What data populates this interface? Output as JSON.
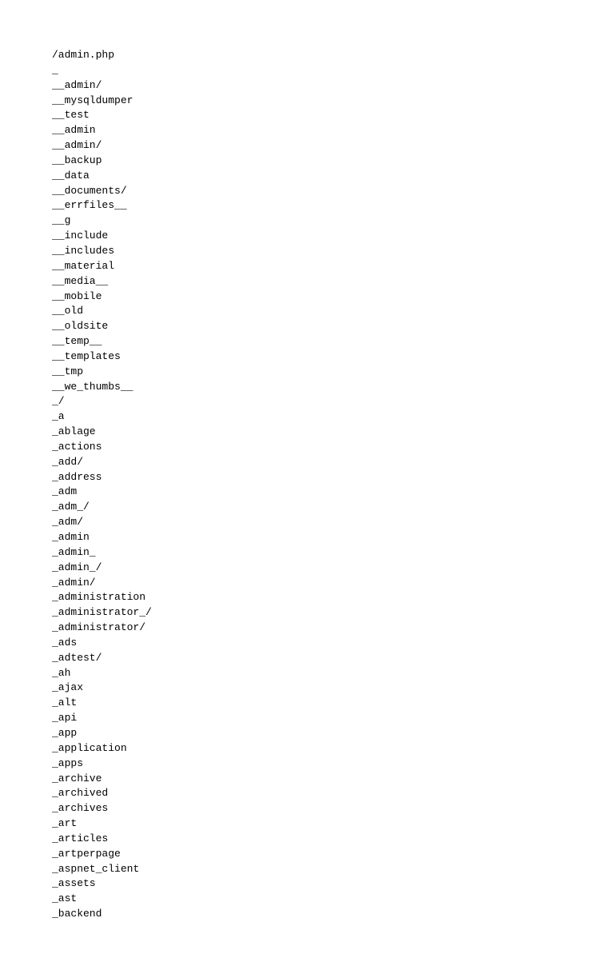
{
  "filelist": {
    "items": [
      "/admin.php",
      "_",
      "__admin/",
      "__mysqldumper",
      "__test",
      "__admin",
      "__admin/",
      "__backup",
      "__data",
      "__documents/",
      "__errfiles__",
      "__g",
      "__include",
      "__includes",
      "__material",
      "__media__",
      "__mobile",
      "__old",
      "__oldsite",
      "__temp__",
      "__templates",
      "__tmp",
      "__we_thumbs__",
      "_/",
      "_a",
      "_ablage",
      "_actions",
      "_add/",
      "_address",
      "_adm",
      "_adm_/",
      "_adm/",
      "_admin",
      "_admin_",
      "_admin_/",
      "_admin/",
      "_administration",
      "_administrator_/",
      "_administrator/",
      "_ads",
      "_adtest/",
      "_ah",
      "_ajax",
      "_alt",
      "_api",
      "_app",
      "_application",
      "_apps",
      "_archive",
      "_archived",
      "_archives",
      "_art",
      "_articles",
      "_artperpage",
      "_aspnet_client",
      "_assets",
      "_ast",
      "_backend"
    ]
  }
}
